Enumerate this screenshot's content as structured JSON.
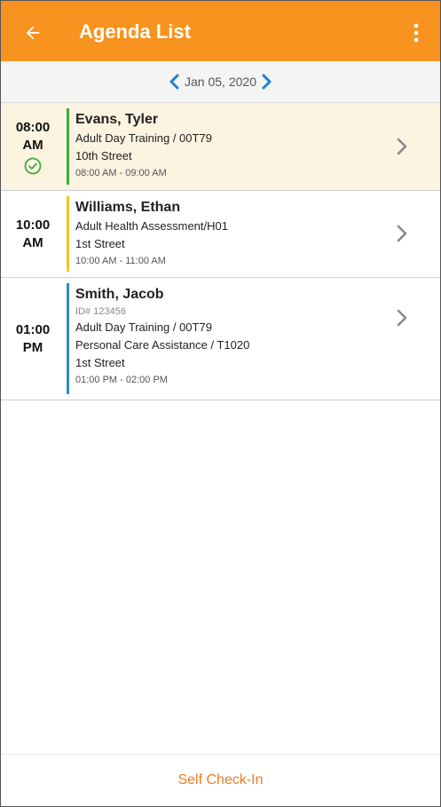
{
  "header": {
    "title": "Agenda List",
    "back_icon": "arrow-left-icon",
    "menu_icon": "more-vertical-icon",
    "color": "#f7931e"
  },
  "date_nav": {
    "date": "Jan 05, 2020",
    "prev_icon": "chevron-left-icon",
    "next_icon": "chevron-right-icon",
    "arrow_color": "#1d7fd6"
  },
  "appointments": [
    {
      "time": "08:00",
      "period": "AM",
      "name": "Evans, Tyler",
      "service": "Adult Day Training / 00T79",
      "location": "10th Street",
      "range": "08:00 AM - 09:00 AM",
      "status_icon": "check-circle-icon",
      "bar_color": "#3cab3c",
      "selected": true
    },
    {
      "time": "10:00",
      "period": "AM",
      "name": "Williams, Ethan",
      "service": "Adult Health Assessment/H01",
      "location": "1st Street",
      "range": "10:00 AM - 11:00 AM",
      "bar_color": "#f5c518"
    },
    {
      "time": "01:00",
      "period": "PM",
      "name": "Smith, Jacob",
      "client_id": "ID# 123456",
      "service": "Adult Day Training / 00T79",
      "service2": "Personal Care Assistance / T1020",
      "location": "1st Street",
      "range": "01:00 PM - 02:00 PM",
      "bar_color": "#2e8fc0"
    }
  ],
  "footer": {
    "self_checkin_label": "Self Check-In",
    "color": "#f07c1e"
  }
}
